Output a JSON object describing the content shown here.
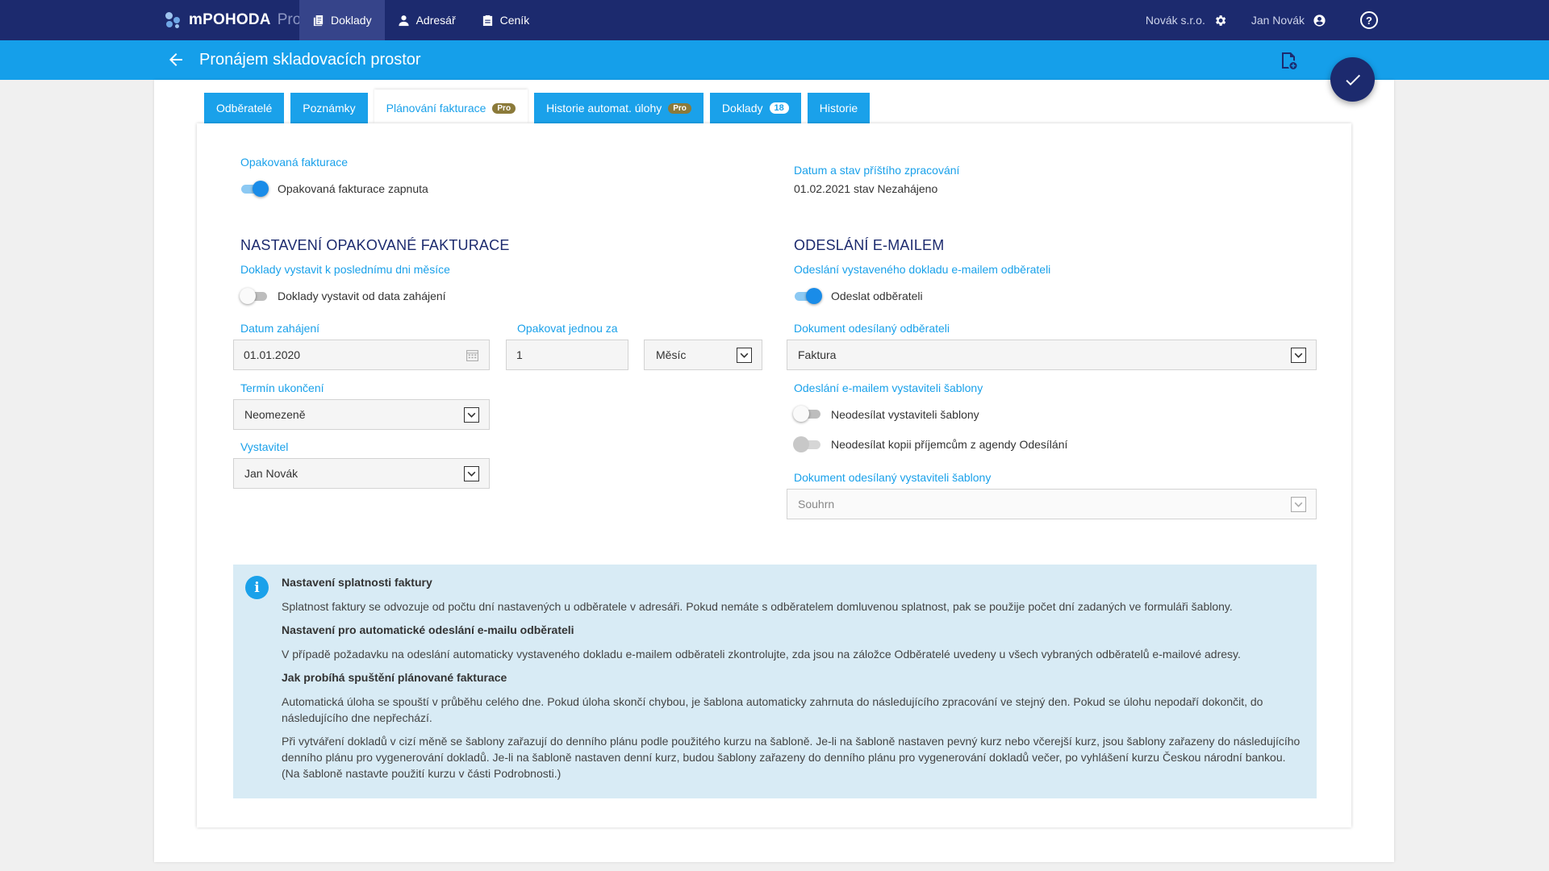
{
  "brand": {
    "name": "mPOHODA",
    "edition": "Pro"
  },
  "nav": [
    {
      "label": "Doklady",
      "icon": "documents-icon",
      "active": true
    },
    {
      "label": "Adresář",
      "icon": "person-icon",
      "active": false
    },
    {
      "label": "Ceník",
      "icon": "pricelist-icon",
      "active": false
    }
  ],
  "header": {
    "company": "Novák s.r.o.",
    "user": "Jan Novák"
  },
  "title": "Pronájem skladovacích prostor",
  "tabs": [
    {
      "label": "Odběratelé"
    },
    {
      "label": "Poznámky"
    },
    {
      "label": "Plánování fakturace",
      "badge": "Pro",
      "active": true
    },
    {
      "label": "Historie automat. úlohy",
      "badge": "Pro"
    },
    {
      "label": "Doklady",
      "count": "18"
    },
    {
      "label": "Historie"
    }
  ],
  "recurring": {
    "label": "Opakovaná fakturace",
    "toggle_label": "Opakovaná fakturace zapnuta",
    "enabled": true
  },
  "next_run": {
    "label": "Datum a stav příštího zpracování",
    "value": "01.02.2021 stav Nezahájeno"
  },
  "settings": {
    "heading": "NASTAVENÍ OPAKOVANÉ FAKTURACE",
    "last_day_label": "Doklady vystavit k poslednímu dni měsíce",
    "from_start_toggle_label": "Doklady vystavit od data zahájení",
    "from_start_enabled": false,
    "start_date_label": "Datum zahájení",
    "start_date_value": "01.01.2020",
    "repeat_label": "Opakovat jednou za",
    "repeat_value": "1",
    "repeat_unit": "Měsíc",
    "end_label": "Termín ukončení",
    "end_value": "Neomezeně",
    "issuer_label": "Vystavitel",
    "issuer_value": "Jan Novák"
  },
  "email": {
    "heading": "ODESLÁNÍ E-MAILEM",
    "to_customer_label": "Odeslání vystaveného dokladu e-mailem odběrateli",
    "send_toggle_label": "Odeslat odběrateli",
    "send_enabled": true,
    "doc_label": "Dokument odesílaný odběrateli",
    "doc_value": "Faktura",
    "templates_label": "Odeslání e-mailem vystaviteli šablony",
    "no_templates_toggle_label": "Neodesílat vystaviteli šablony",
    "no_templates_enabled": false,
    "no_copy_toggle_label": "Neodesílat kopii příjemcům z agendy Odesílání",
    "no_copy_enabled": false,
    "issuer_doc_label": "Dokument odesílaný vystaviteli šablony",
    "issuer_doc_value": "Souhrn"
  },
  "info": {
    "h1": "Nastavení splatnosti faktury",
    "p1": "Splatnost faktury se odvozuje od počtu dní nastavených u odběratele v adresáři. Pokud nemáte s odběratelem domluvenou splatnost, pak se použije počet dní zadaných ve formuláři šablony.",
    "h2": "Nastavení pro automatické odeslání e-mailu odběrateli",
    "p2": "V případě požadavku na odeslání automaticky vystaveného dokladu e-mailem odběrateli zkontrolujte, zda jsou na záložce Odběratelé uvedeny u všech vybraných odběratelů e-mailové adresy.",
    "h3": "Jak probíhá spuštění plánované fakturace",
    "p3": "Automatická úloha se spouští v průběhu celého dne. Pokud úloha skončí chybou, je šablona automaticky zahrnuta do následujícího zpracování ve stejný den. Pokud se úlohu nepodaří dokončit, do následujícího dne nepřechází.",
    "p4": "Při vytváření dokladů v cizí měně se šablony zařazují do denního plánu podle použitého kurzu na šabloně. Je-li na šabloně nastaven pevný kurz nebo včerejší kurz, jsou šablony zařazeny do následujícího denního plánu pro vygenerování dokladů. Je-li na šabloně nastaven denní kurz, budou šablony zařazeny do denního plánu pro vygenerování dokladů večer, po vyhlášení kurzu Českou národní bankou. (Na šabloně nastavte použití kurzu v části Podrobnosti.)"
  }
}
